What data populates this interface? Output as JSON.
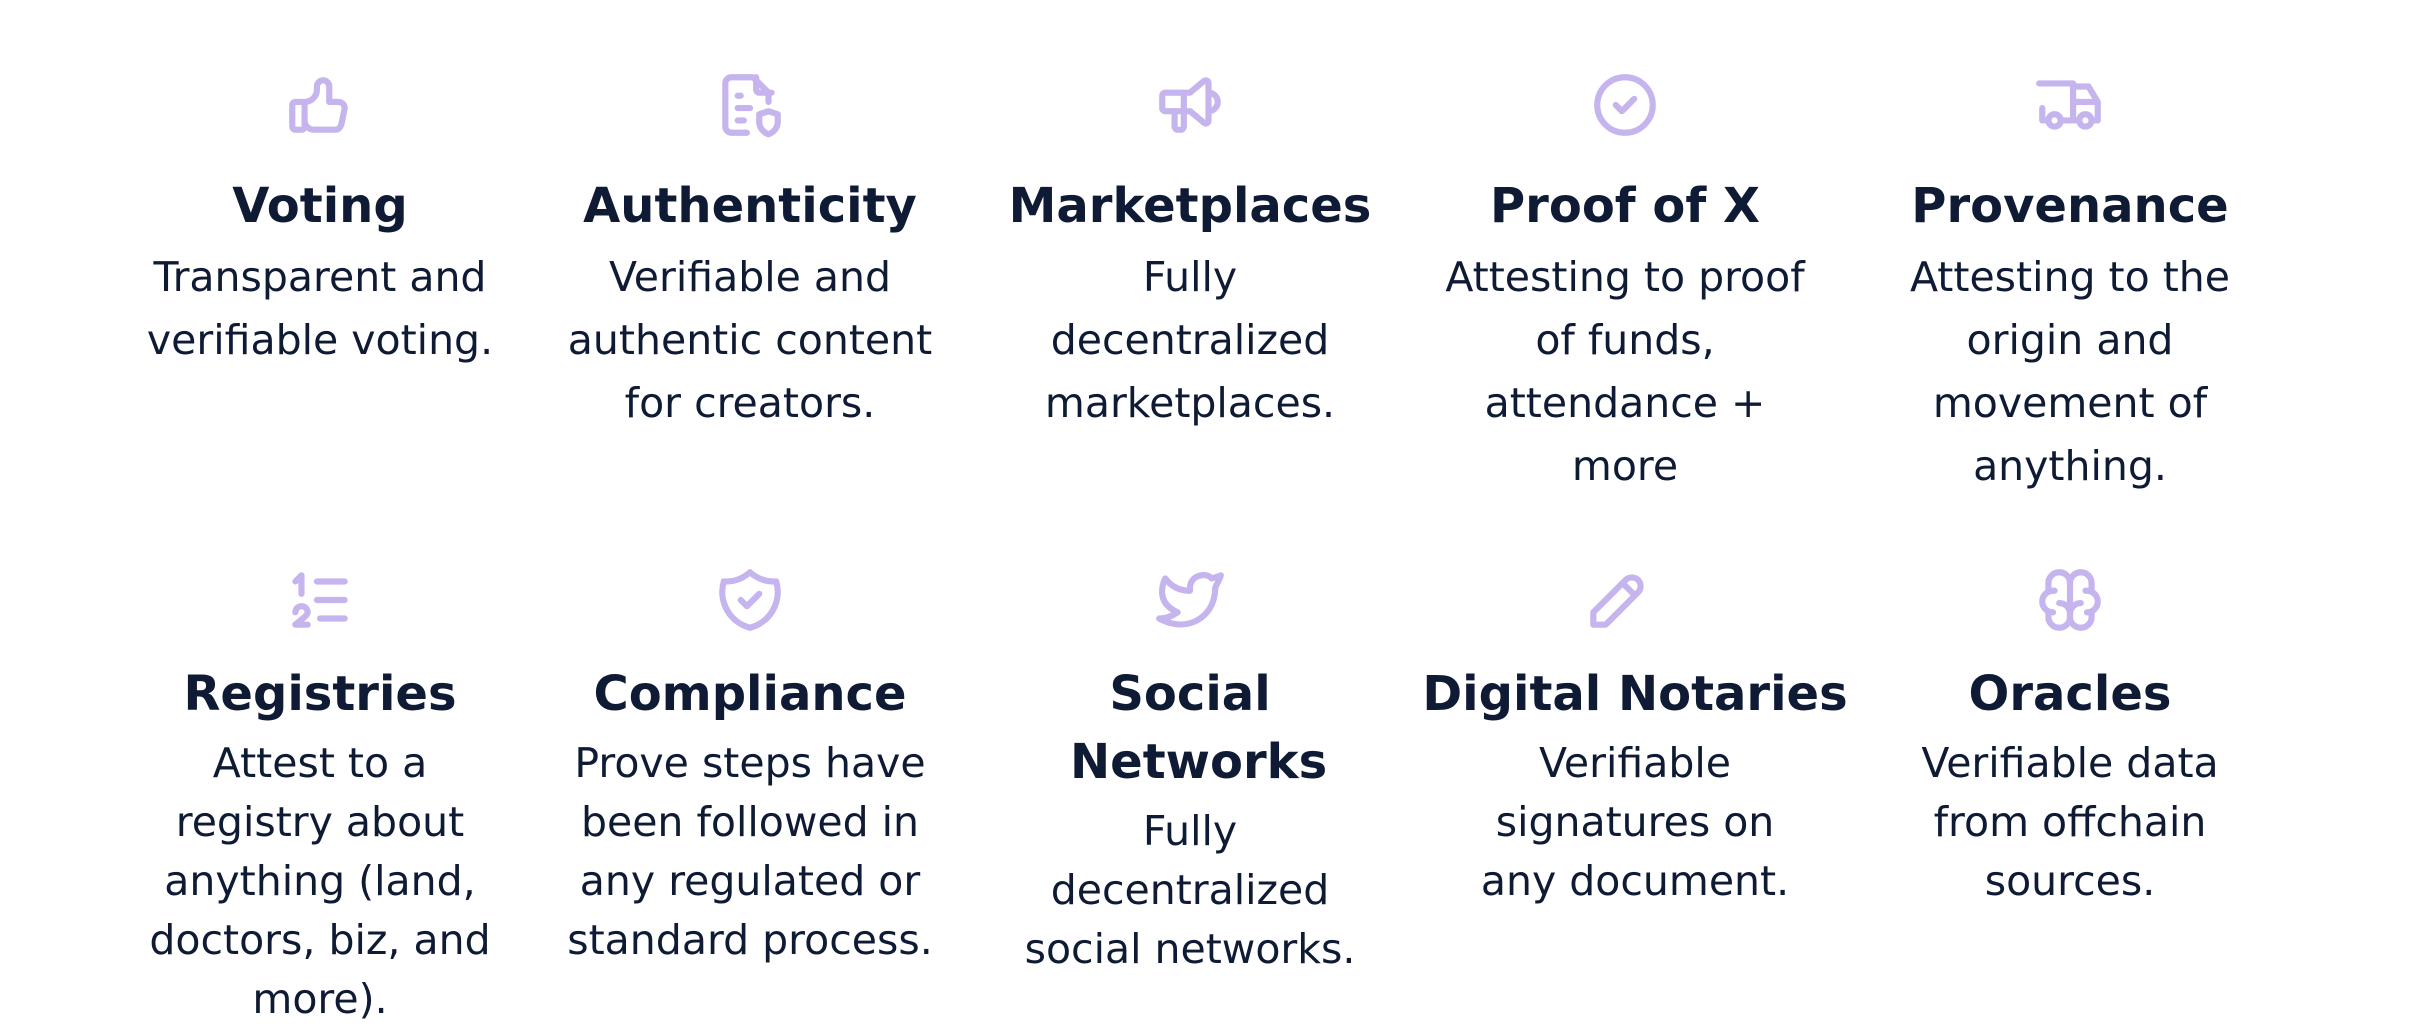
{
  "colors": {
    "icon": "#c6b4ee",
    "text": "#0f1b34",
    "background": "#ffffff"
  },
  "features": [
    {
      "icon": "thumbs-up-icon",
      "title": "Voting",
      "description": "Transparent and verifiable voting."
    },
    {
      "icon": "document-shield-icon",
      "title": "Authenticity",
      "description": "Verifiable and authentic content for creators."
    },
    {
      "icon": "megaphone-icon",
      "title": "Marketplaces",
      "description": "Fully decentralized marketplaces."
    },
    {
      "icon": "check-circle-icon",
      "title": "Proof of X",
      "description": "Attesting to proof of funds, attendance + more"
    },
    {
      "icon": "truck-icon",
      "title": "Provenance",
      "description": "Attesting to the origin and movement of anything."
    },
    {
      "icon": "numbered-list-icon",
      "title": "Registries",
      "description": "Attest to a registry about anything (land, doctors, biz, and more)."
    },
    {
      "icon": "shield-check-icon",
      "title": "Compliance",
      "description": "Prove steps have been followed in any regulated or standard process."
    },
    {
      "icon": "twitter-bird-icon",
      "title": "Social Networks",
      "description": "Fully decentralized social networks."
    },
    {
      "icon": "pencil-icon",
      "title": "Digital Notaries",
      "description": "Verifiable signatures on any document."
    },
    {
      "icon": "brain-icon",
      "title": "Oracles",
      "description": "Verifiable data from offchain sources."
    }
  ]
}
